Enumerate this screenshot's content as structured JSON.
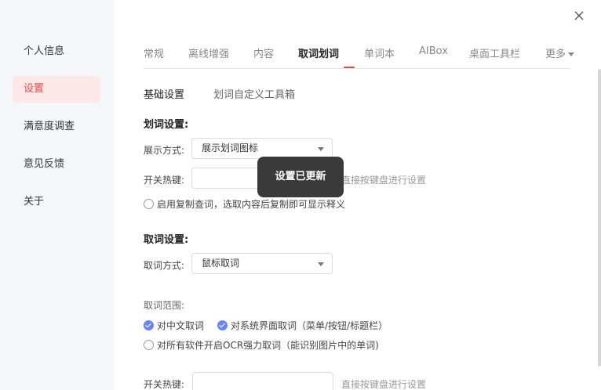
{
  "sidebar": {
    "items": [
      {
        "label": "个人信息"
      },
      {
        "label": "设置"
      },
      {
        "label": "满意度调查"
      },
      {
        "label": "意见反馈"
      },
      {
        "label": "关于"
      }
    ]
  },
  "tabs": [
    {
      "label": "常规"
    },
    {
      "label": "离线增强"
    },
    {
      "label": "内容"
    },
    {
      "label": "取词划词"
    },
    {
      "label": "单词本"
    },
    {
      "label": "AIBox"
    },
    {
      "label": "桌面工具栏"
    },
    {
      "label": "更多"
    }
  ],
  "subtabs": [
    {
      "label": "基础设置"
    },
    {
      "label": "划词自定义工具箱"
    }
  ],
  "highlight_section": {
    "title": "划词设置:",
    "display_label": "展示方式:",
    "display_value": "展示划词图标",
    "hotkey_label": "开关热键:",
    "hotkey_hint": "直接按键盘进行设置",
    "copy_lookup_label": "启用复制查词，选取内容后复制即可显示释义"
  },
  "capture_section": {
    "title": "取词设置:",
    "method_label": "取词方式:",
    "method_value": "鼠标取词",
    "range_label": "取词范围:",
    "chinese_label": "对中文取词",
    "system_ui_label": "对系统界面取词（菜单/按钮/标题栏）",
    "ocr_label": "对所有软件开启OCR强力取词（能识别图片中的单词)",
    "hotkey_label": "开关热键:",
    "hotkey_hint": "直接按键盘进行设置"
  },
  "toast": {
    "text": "设置已更新"
  },
  "colors": {
    "accent": "#e84a4a",
    "check": "#6b85f0",
    "sidebar_bg": "#f5f6fa",
    "toast_bg": "#3a3a3a"
  },
  "icons": {
    "close": "close-icon",
    "dropdown": "chevron-down-icon"
  }
}
